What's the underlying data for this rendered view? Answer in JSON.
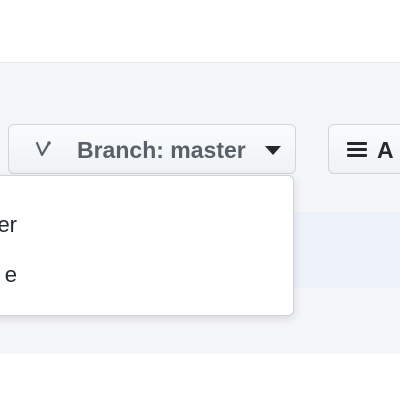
{
  "toolbar": {
    "branch_button": {
      "prefix": "Branch:",
      "value": "master",
      "label": "Branch: master",
      "icon": "branch-icon"
    },
    "secondary_button": {
      "label": "A",
      "icon": "list-icon"
    }
  },
  "dropdown": {
    "items": [
      {
        "label": "er"
      },
      {
        "label": "e"
      }
    ]
  },
  "colors": {
    "page_background": "#ffffff",
    "toolbar_background": "#f5f6f8",
    "selected_row_background": "#eef2fb",
    "button_border": "#d1d5da",
    "branch_text": "#586069",
    "primary_text": "#24292e"
  }
}
